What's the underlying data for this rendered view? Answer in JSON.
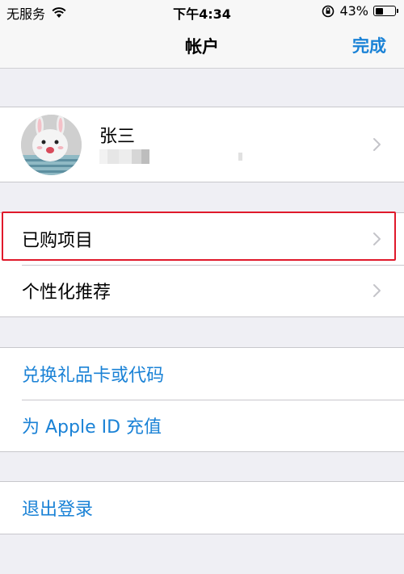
{
  "status_bar": {
    "carrier": "无服务",
    "time": "下午4:34",
    "battery_percent": "43%",
    "battery_level": 0.43
  },
  "nav": {
    "title": "帐户",
    "done_label": "完成"
  },
  "profile": {
    "name": "张三"
  },
  "section1": {
    "purchased": "已购项目",
    "personalized": "个性化推荐"
  },
  "section2": {
    "redeem": "兑换礼品卡或代码",
    "add_funds": "为 Apple ID 充值"
  },
  "section3": {
    "sign_out": "退出登录"
  },
  "colors": {
    "accent": "#1a82d6",
    "highlight": "#e0192b",
    "background": "#efeff4"
  }
}
